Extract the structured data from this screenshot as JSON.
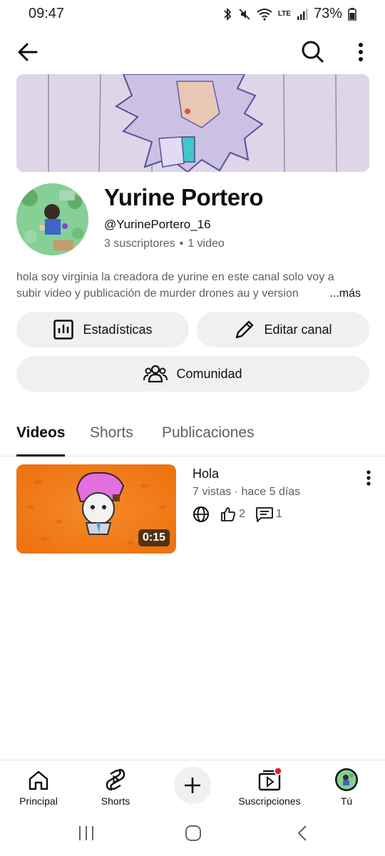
{
  "status_bar": {
    "time": "09:47",
    "network": "LTE",
    "battery": "73%"
  },
  "channel": {
    "name": "Yurine Portero",
    "handle": "@YurinePortero_16",
    "subscribers": "3 suscriptores",
    "video_count": "1 video",
    "description_line1": "hola soy virginia la creadora de yurine en este canal solo voy a",
    "description_line2": "subir video y publicación de murder drones au y version",
    "more_label": "...más"
  },
  "actions": {
    "stats_label": "Estadísticas",
    "edit_label": "Editar canal",
    "community_label": "Comunidad"
  },
  "tabs": [
    {
      "label": "Videos",
      "active": true
    },
    {
      "label": "Shorts",
      "active": false
    },
    {
      "label": "Publicaciones",
      "active": false
    }
  ],
  "videos": [
    {
      "title": "Hola",
      "meta": "7 vistas · hace 5 días",
      "duration": "0:15",
      "likes": "2",
      "comments": "1",
      "visibility_icon": "globe-icon"
    }
  ],
  "bottom_nav": [
    {
      "label": "Principal",
      "icon": "home-icon"
    },
    {
      "label": "Shorts",
      "icon": "shorts-icon"
    },
    {
      "label": "",
      "icon": "plus-icon"
    },
    {
      "label": "Suscripciones",
      "icon": "subscriptions-icon"
    },
    {
      "label": "Tú",
      "icon": "avatar"
    }
  ],
  "colors": {
    "pill_bg": "#f0f0f0",
    "thumbnail_orange": "#f07f1c",
    "notification_red": "#e52020",
    "secondary_text": "#606060"
  }
}
